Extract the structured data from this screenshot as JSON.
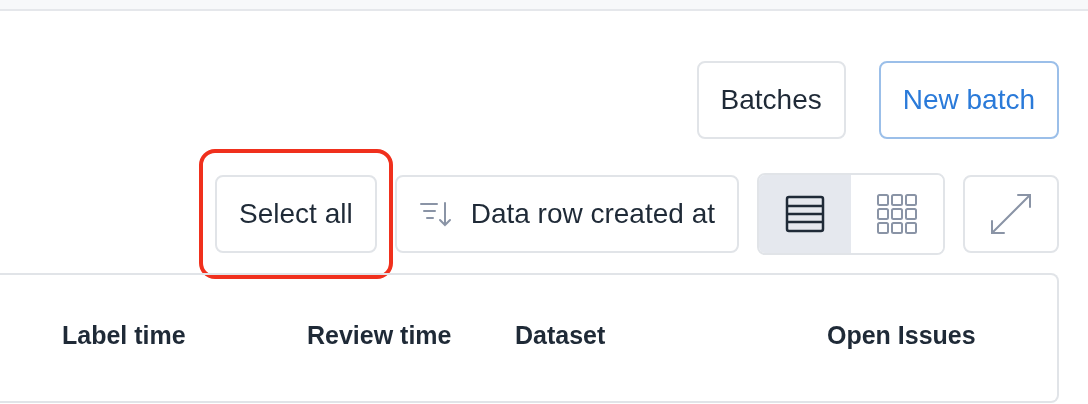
{
  "header_buttons": [
    {
      "label": "Batches",
      "kind": "default"
    },
    {
      "label": "New batch",
      "kind": "primary"
    }
  ],
  "toolbar": {
    "select_all": {
      "label": "Select all",
      "highlighted": true
    },
    "sort": {
      "label": "Data row created at"
    },
    "view_modes": [
      {
        "kind": "list",
        "selected": true
      },
      {
        "kind": "grid",
        "selected": false
      }
    ]
  },
  "table": {
    "columns": [
      "Label time",
      "Review time",
      "Dataset",
      "Open Issues"
    ]
  }
}
